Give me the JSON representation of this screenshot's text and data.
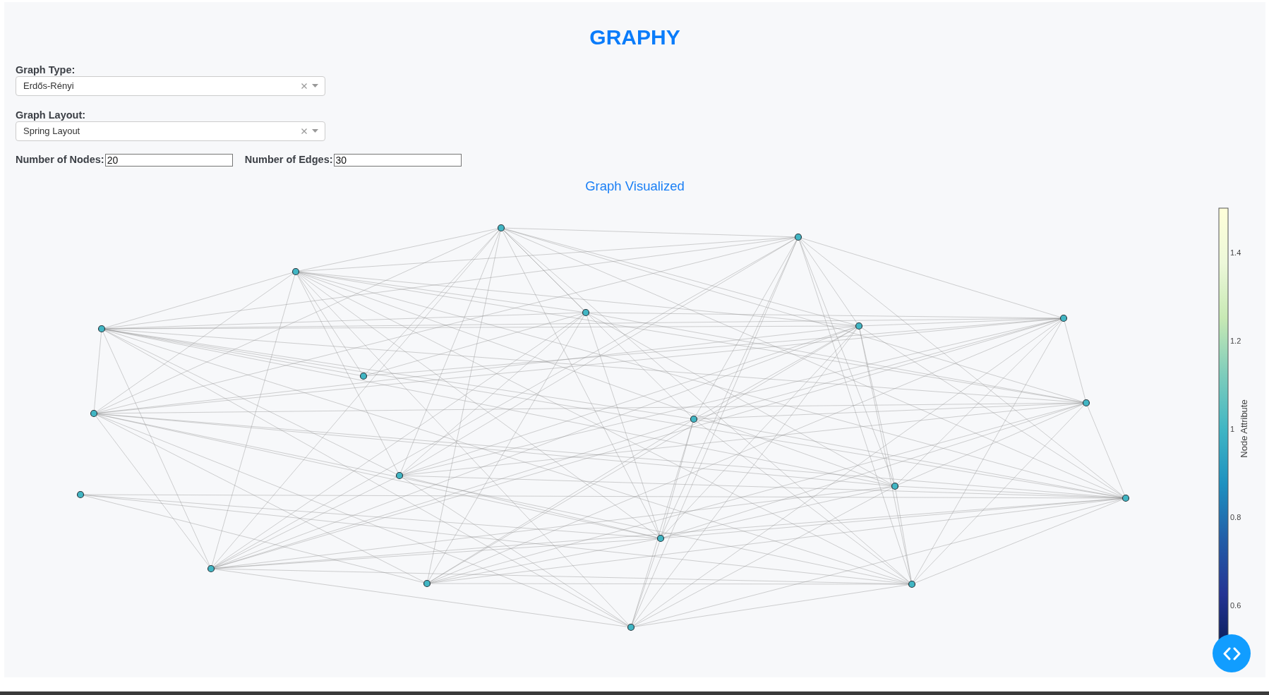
{
  "title": "GRAPHY",
  "dropdowns": [
    {
      "label": "Graph Type:",
      "value": "Erdős-Rényi"
    },
    {
      "label": "Graph Layout:",
      "value": "Spring Layout"
    }
  ],
  "number_inputs": [
    {
      "label": "Number of Nodes:",
      "value": "20"
    },
    {
      "label": "Number of Edges:",
      "value": "30"
    }
  ],
  "graph": {
    "title": "Graph Visualized",
    "colorbar": {
      "title": "Node Attribute",
      "tick_labels": [
        "1.4",
        "1.2",
        "1",
        "0.8",
        "0.6"
      ]
    }
  }
}
